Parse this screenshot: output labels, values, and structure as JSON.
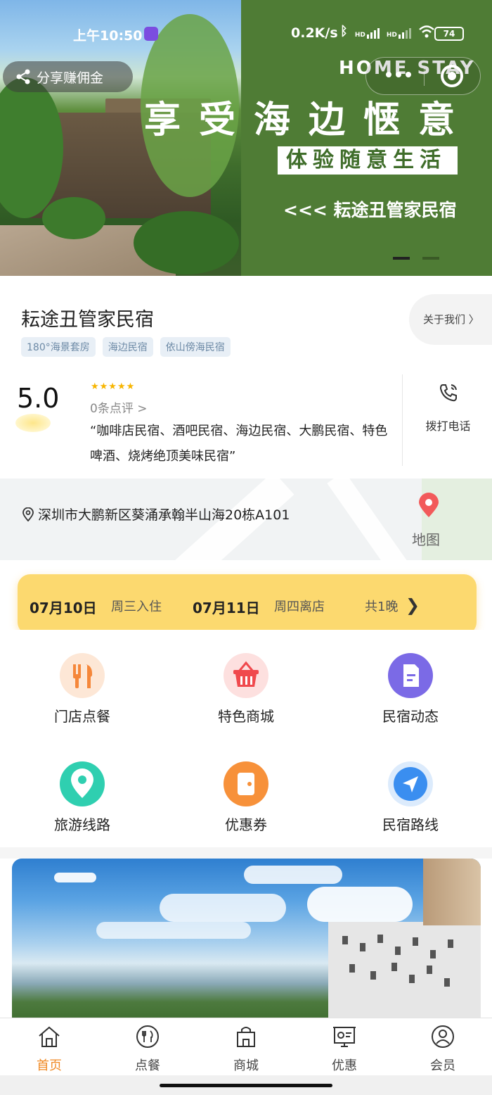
{
  "status_bar": {
    "time": "上午10:50",
    "network_speed": "0.2K/s",
    "signal_1": "HD",
    "signal_2": "HD",
    "battery": "74"
  },
  "hero": {
    "share_label": "分享赚佣金",
    "brand_en": "HOME STAY",
    "title": "享受海边惬意",
    "subtitle": "体验随意生活",
    "brand_line": "<<< 耘途丑管家民宿",
    "page_count": 2,
    "active_page": 1
  },
  "shop": {
    "name": "耘途丑管家民宿",
    "tags": [
      "180°海景套房",
      "海边民宿",
      "依山傍海民宿"
    ],
    "about_label": "关于我们 〉",
    "rating": "5.0",
    "stars": "★★★★★",
    "reviews": "0条点评 >",
    "description": "“咖啡店民宿、酒吧民宿、海边民宿、大鹏民宿、特色啤酒、烧烤绝顶美味民宿”",
    "call_label": "拨打电话"
  },
  "address": {
    "text": "深圳市大鹏新区葵涌承翰半山海20栋A101",
    "map_label": "地图"
  },
  "booking": {
    "checkin_date": "07月10日",
    "checkin_label": "周三入住",
    "checkout_date": "07月11日",
    "checkout_label": "周四离店",
    "nights": "共1晚",
    "chevron": "❯"
  },
  "services": [
    {
      "label": "门店点餐",
      "icon": "utensils-icon",
      "color": "#f5873a"
    },
    {
      "label": "特色商城",
      "icon": "basket-icon",
      "color": "#f0494d"
    },
    {
      "label": "民宿动态",
      "icon": "document-icon",
      "color": "#7b6ae6"
    },
    {
      "label": "旅游线路",
      "icon": "location-icon",
      "color": "#2fcfb0"
    },
    {
      "label": "优惠券",
      "icon": "coupon-icon",
      "color": "#f7913a"
    },
    {
      "label": "民宿路线",
      "icon": "navigation-icon",
      "color": "#3a8ef0"
    }
  ],
  "tabbar": {
    "items": [
      {
        "label": "首页",
        "icon": "home-icon",
        "active": true
      },
      {
        "label": "点餐",
        "icon": "dining-icon",
        "active": false
      },
      {
        "label": "商城",
        "icon": "shop-icon",
        "active": false
      },
      {
        "label": "优惠",
        "icon": "promo-icon",
        "active": false
      },
      {
        "label": "会员",
        "icon": "member-icon",
        "active": false
      }
    ],
    "active_color": "#f08a25"
  },
  "colors": {
    "hero_green": "#4f7c35",
    "booking_yellow": "#fcd96f",
    "star_gold": "#f7b500"
  }
}
